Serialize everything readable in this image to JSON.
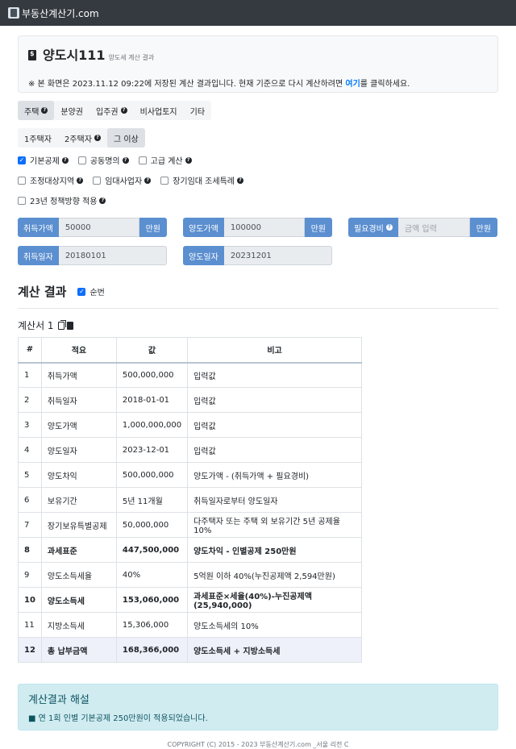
{
  "navbar": {
    "brand": "부동산계산기.com"
  },
  "jumbotron": {
    "title": "양도시111",
    "subtitle": "양도세 계산 결과",
    "note_prefix": "※ 본 화면은 2023.11.12 09:22에 저장된 계산 결과입니다. 현재 기준으로 다시 계산하려면 ",
    "note_link": "여기",
    "note_suffix": "를 클릭하세요."
  },
  "property_tabs": [
    {
      "label": "주택",
      "help": true,
      "active": true
    },
    {
      "label": "분양권",
      "help": false,
      "active": false
    },
    {
      "label": "입주권",
      "help": true,
      "active": false
    },
    {
      "label": "비사업토지",
      "help": false,
      "active": false
    },
    {
      "label": "기타",
      "help": false,
      "active": false
    }
  ],
  "house_count_tabs": [
    {
      "label": "1주택자",
      "active": false
    },
    {
      "label": "2주택자",
      "help": true,
      "active": false
    },
    {
      "label": "그 이상",
      "active": true
    }
  ],
  "options": {
    "row1": [
      {
        "label": "기본공제",
        "checked": true,
        "help": true
      },
      {
        "label": "공동명의",
        "checked": false,
        "help": true
      },
      {
        "label": "고급 계산",
        "checked": false,
        "help": true
      }
    ],
    "row2": [
      {
        "label": "조정대상지역",
        "checked": false,
        "help": true
      },
      {
        "label": "임대사업자",
        "checked": false,
        "help": true
      },
      {
        "label": "장기임대 조세특례",
        "checked": false,
        "help": true
      }
    ],
    "row3": [
      {
        "label": "23년 정책방향 적용",
        "checked": false,
        "help": true
      }
    ]
  },
  "inputs": {
    "acquire_price": {
      "label": "취득가액",
      "value": "50000",
      "unit": "만원"
    },
    "transfer_price": {
      "label": "양도가액",
      "value": "100000",
      "unit": "만원"
    },
    "expenses": {
      "label": "필요경비",
      "placeholder": "금액 입력",
      "unit": "만원"
    },
    "acquire_date": {
      "label": "취득일자",
      "value": "20180101"
    },
    "transfer_date": {
      "label": "양도일자",
      "value": "20231201"
    }
  },
  "result": {
    "heading": "계산 결과",
    "order_label": "순번",
    "order_checked": true,
    "sheet_title": "계산서 1"
  },
  "table": {
    "headers": [
      "#",
      "적요",
      "값",
      "비고"
    ],
    "rows": [
      {
        "no": "1",
        "item": "취득가액",
        "value": "500,000,000",
        "note": "입력값"
      },
      {
        "no": "2",
        "item": "취득일자",
        "value": "2018-01-01",
        "note": "입력값"
      },
      {
        "no": "3",
        "item": "양도가액",
        "value": "1,000,000,000",
        "note": "입력값"
      },
      {
        "no": "4",
        "item": "양도일자",
        "value": "2023-12-01",
        "note": "입력값"
      },
      {
        "no": "5",
        "item": "양도차익",
        "value": "500,000,000",
        "note": "양도가액 - (취득가액 + 필요경비)"
      },
      {
        "no": "6",
        "item": "보유기간",
        "value": "5년 11개월",
        "note": "취득일자로부터 양도일자"
      },
      {
        "no": "7",
        "item": "장기보유특별공제",
        "value": "50,000,000",
        "note": "다주택자 또는 주택 외 보유기간 5년 공제율 10%"
      },
      {
        "no": "8",
        "item": "과세표준",
        "value": "447,500,000",
        "note": "양도차익 - 인별공제 250만원",
        "bold": true
      },
      {
        "no": "9",
        "item": "양도소득세율",
        "value": "40%",
        "note": "5억원 이하 40%(누진공제액 2,594만원)"
      },
      {
        "no": "10",
        "item": "양도소득세",
        "value": "153,060,000",
        "note": "과세표준×세율(40%)-누진공제액(25,940,000)",
        "bold": true
      },
      {
        "no": "11",
        "item": "지방소득세",
        "value": "15,306,000",
        "note": "양도소득세의 10%"
      },
      {
        "no": "12",
        "item": "총 납부금액",
        "value": "168,366,000",
        "note": "양도소득세 + 지방소득세",
        "bold": true,
        "highlight": true
      }
    ]
  },
  "explanation": {
    "title": "계산결과 해설",
    "text": "■ 연 1회 인별 기본공제 250만원이 적용되었습니다."
  },
  "footer": {
    "text": "COPYRIGHT (C) 2015 - 2023 부동산계산기.com _서울 리전 C"
  },
  "colors": {
    "navbar": "#343a40",
    "label_blue": "#5b8fd0",
    "link": "#007bff",
    "alert_bg": "#d1ecf1",
    "alert_text": "#0c5460"
  }
}
